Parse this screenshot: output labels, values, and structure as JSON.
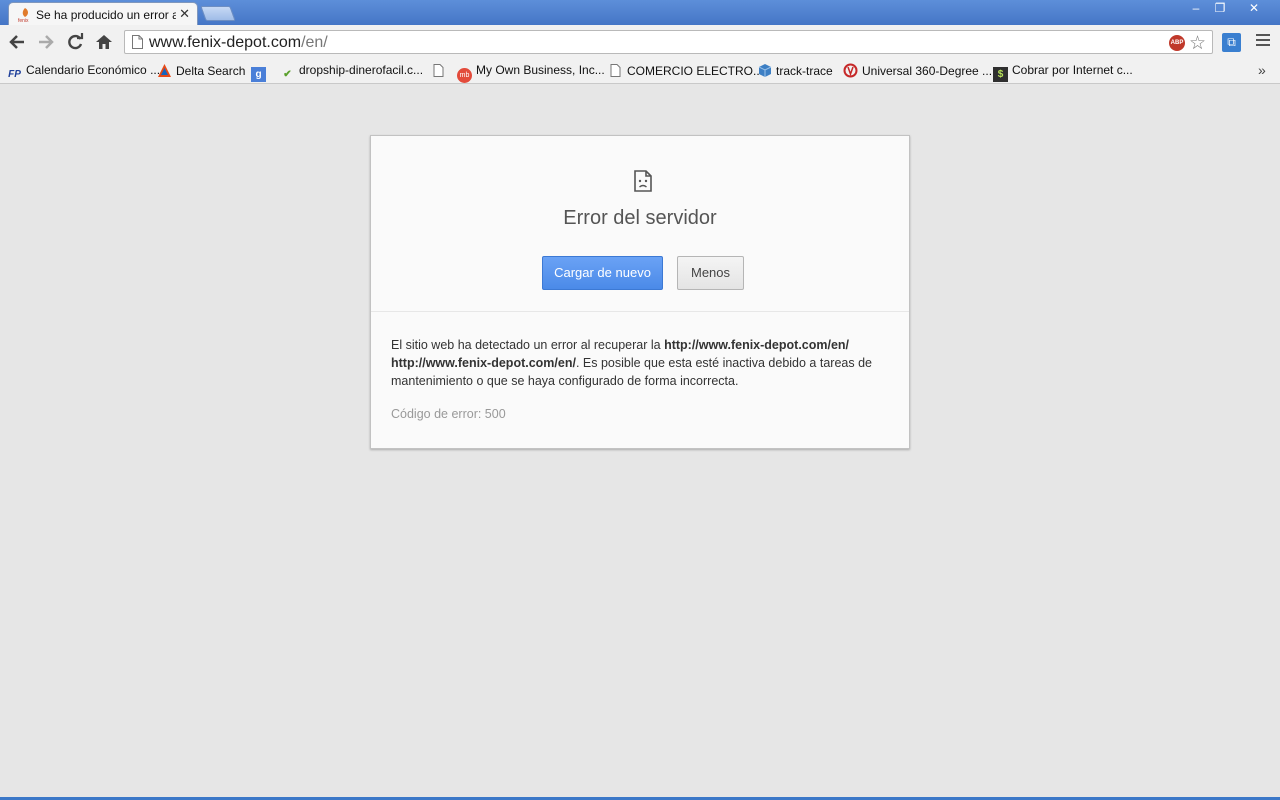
{
  "window": {
    "tab_title": "Se ha producido un error al c",
    "controls": {
      "minimize": "–",
      "maximize": "❐",
      "close": "✕"
    }
  },
  "toolbar": {
    "url_host": "www.fenix-depot.com",
    "url_path": "/en/",
    "extensions": {
      "adblock": "ABP"
    }
  },
  "bookmarks": [
    {
      "label": "Calendario Económico ...",
      "icon": "fp-logo-icon"
    },
    {
      "label": "Delta Search",
      "icon": "delta-icon"
    },
    {
      "label": "",
      "icon": "google-icon"
    },
    {
      "label": "dropship-dinerofacil.c...",
      "icon": "checkmark-icon"
    },
    {
      "label": "",
      "icon": "page-icon"
    },
    {
      "label": "My Own Business, Inc...",
      "icon": "mob-icon"
    },
    {
      "label": "COMERCIO ELECTRO...",
      "icon": "page-icon"
    },
    {
      "label": "track-trace",
      "icon": "box-icon"
    },
    {
      "label": "Universal 360-Degree ...",
      "icon": "universal-icon"
    },
    {
      "label": "Cobrar por Internet c...",
      "icon": "dollar-icon"
    }
  ],
  "bookmarks_more": "»",
  "error_page": {
    "title": "Error del servidor",
    "reload_button": "Cargar de nuevo",
    "less_button": "Menos",
    "details_prefix": "El sitio web ha detectado un error al recuperar la ",
    "details_url_1": "http://www.fenix-depot.com/en/",
    "details_url_2": "http://www.fenix-depot.com/en/",
    "details_suffix": ". Es posible que esta esté inactiva debido a tareas de mantenimiento o que se haya configurado de forma incorrecta.",
    "error_code": "Código de error: 500"
  },
  "colors": {
    "accent": "#4b8ae8",
    "titlebar": "#4576c6",
    "background": "#e6e6e6"
  }
}
